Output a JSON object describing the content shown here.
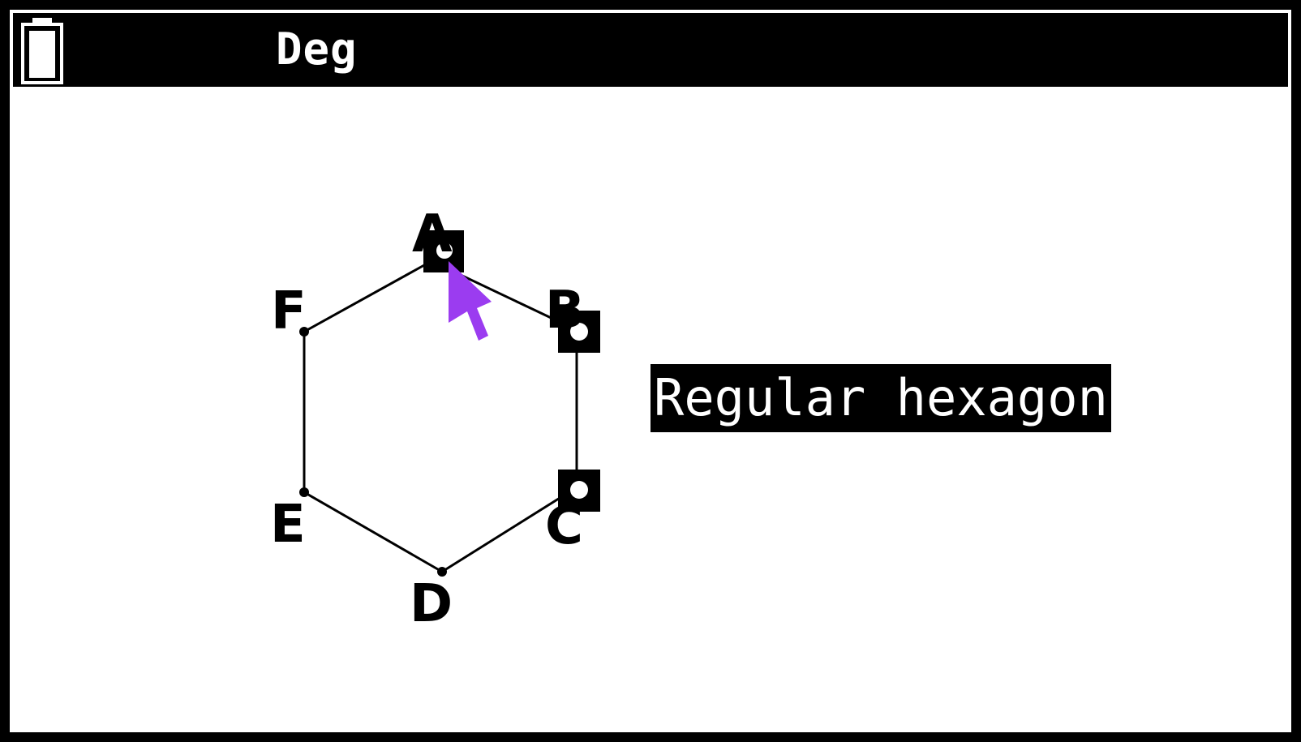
{
  "status_bar": {
    "battery_icon": "battery-icon",
    "angle_mode": "Deg"
  },
  "figure": {
    "shape_name": "Regular hexagon",
    "vertices": [
      "A",
      "B",
      "C",
      "D",
      "E",
      "F"
    ],
    "selected_vertices": [
      "A",
      "B",
      "C"
    ],
    "cursor_color": "#9b3cf0"
  }
}
